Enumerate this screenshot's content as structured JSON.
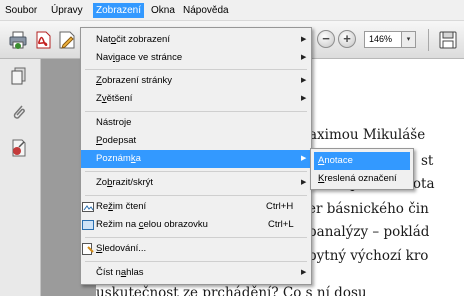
{
  "menubar": {
    "items": [
      {
        "label": "Soubor"
      },
      {
        "label": "Úpravy"
      },
      {
        "label": "Zobrazení"
      },
      {
        "label": "Okna"
      },
      {
        "label": "Nápověda"
      }
    ]
  },
  "toolbar": {
    "zoom_value": "146%",
    "zoom_dropdown_glyph": "▾",
    "zoom_out_glyph": "−",
    "zoom_in_glyph": "+"
  },
  "view_menu": {
    "items": {
      "rotate": {
        "pre": "Nat",
        "key": "o",
        "post": "čit zobrazení"
      },
      "navigate": {
        "pre": "Nav",
        "key": "i",
        "post": "gace ve stránce"
      },
      "page_display": {
        "pre": "",
        "key": "Z",
        "post": "obrazení stránky"
      },
      "zoom": {
        "pre": "Z",
        "key": "v",
        "post": "ětšení"
      },
      "tools": {
        "pre": "Nástroje",
        "key": "",
        "post": ""
      },
      "sign": {
        "pre": "",
        "key": "P",
        "post": "odepsat"
      },
      "comment": {
        "pre": "Poznám",
        "key": "k",
        "post": "a"
      },
      "show_hide": {
        "pre": "Zo",
        "key": "b",
        "post": "razit/skrýt"
      },
      "read_mode": {
        "pre": "Re",
        "key": "ž",
        "post": "im čtení",
        "shortcut": "Ctrl+H"
      },
      "full_screen": {
        "pre": "Režim na ",
        "key": "c",
        "post": "elou obrazovku",
        "shortcut": "Ctrl+L"
      },
      "tracker": {
        "pre": "",
        "key": "S",
        "post": "ledování..."
      },
      "read_aloud": {
        "pre": "Číst n",
        "key": "a",
        "post": "hlas"
      }
    },
    "arrow_glyph": "▶"
  },
  "comment_submenu": {
    "items": {
      "annotations": {
        "pre": "",
        "key": "A",
        "post": "notace"
      },
      "annotation_markups": {
        "pre": "",
        "key": "K",
        "post": "reslená označení"
      }
    }
  },
  "document": {
    "lines": [
      "aximou Mikuláše",
      "st",
      "a „zodpovídání ota",
      "er básnického čin",
      "panalýzy – poklád",
      "pytný výchozí kro",
      "uskutečnost ze prchádění? Co s ní dosu"
    ]
  },
  "icons": [
    "print-icon",
    "create-pdf-icon",
    "edit-icon",
    "zoom-out-icon",
    "zoom-in-icon",
    "save-icon",
    "pages-icon",
    "attachments-icon",
    "signatures-icon",
    "read-mode-icon",
    "full-screen-icon",
    "tracker-icon"
  ],
  "colors": {
    "highlight": "#3399ff",
    "menu_bg": "#f0f0f0",
    "doc_bg": "#9b9b9b"
  }
}
